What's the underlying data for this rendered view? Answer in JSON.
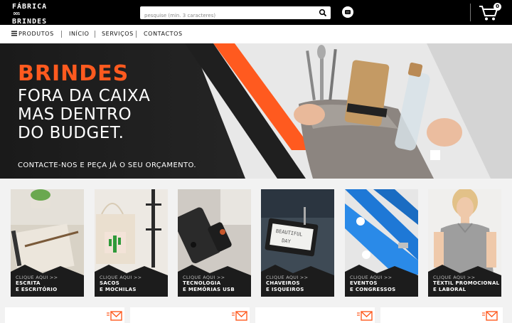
{
  "header": {
    "logo": {
      "line1": "FÁBRICA",
      "line2_small": "DOS",
      "line3": "BRINDES"
    },
    "search": {
      "placeholder": "pesquise (min. 3 caracteres)"
    },
    "cart": {
      "count": "0"
    }
  },
  "nav": {
    "items": [
      "PRODUTOS",
      "INÍCIO",
      "SERVIÇOS",
      "CONTACTOS"
    ]
  },
  "hero": {
    "headline": "BRINDES",
    "lines": [
      "FORA DA CAIXA",
      "MAS DENTRO",
      "DO BUDGET."
    ],
    "cta": "CONTACTE-NOS E PEÇA JÁ O SEU ORÇAMENTO.",
    "accent_color": "#ff5a1f"
  },
  "categories": [
    {
      "cta": "CLIQUE AQUI >>",
      "line1": "ESCRITA",
      "line2": "E ESCRITÓRIO"
    },
    {
      "cta": "CLIQUE AQUI >>",
      "line1": "SACOS",
      "line2": "E MOCHILAS"
    },
    {
      "cta": "CLIQUE AQUI >>",
      "line1": "TECNOLOGIA",
      "line2": "E MEMÓRIAS USB"
    },
    {
      "cta": "CLIQUE AQUI >>",
      "line1": "CHAVEIROS",
      "line2": "E ISQUEIROS"
    },
    {
      "cta": "CLIQUE AQUI >>",
      "line1": "EVENTOS",
      "line2": "E CONGRESSOS"
    },
    {
      "cta": "CLIQUE AQUI >>",
      "line1": "TÊXTIL PROMOCIONAL",
      "line2": "E LABORAL"
    }
  ]
}
